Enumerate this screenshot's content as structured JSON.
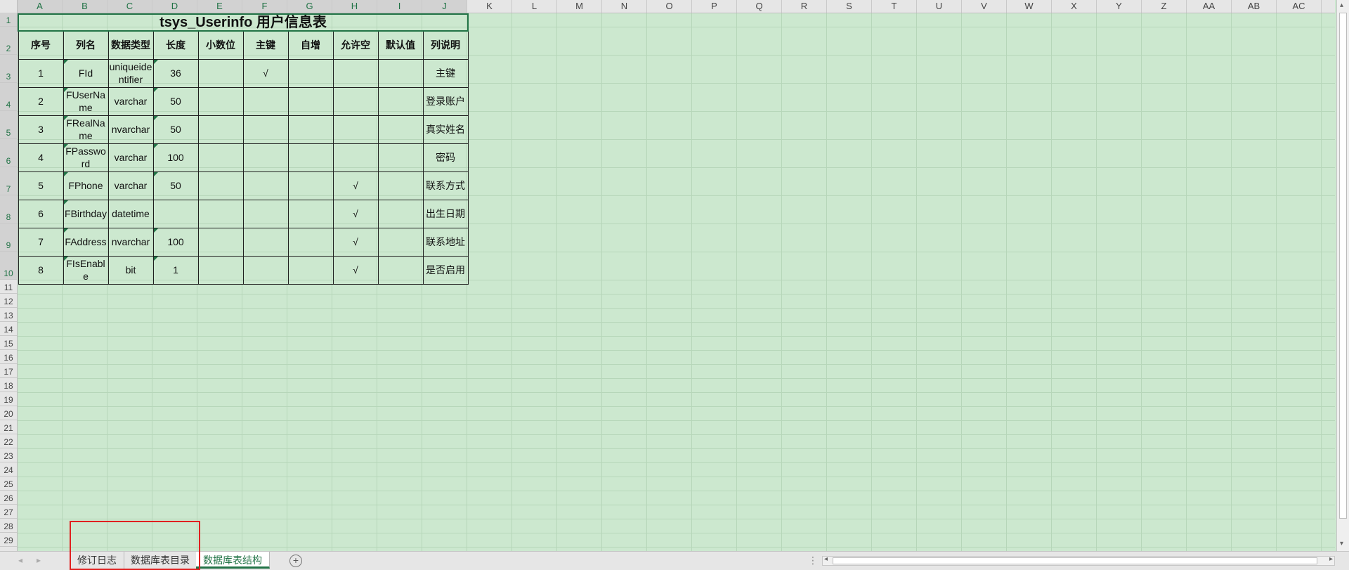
{
  "columns": [
    "A",
    "B",
    "C",
    "D",
    "E",
    "F",
    "G",
    "H",
    "I",
    "J",
    "K",
    "L",
    "M",
    "N",
    "O",
    "P",
    "Q",
    "R",
    "S",
    "T",
    "U",
    "V",
    "W",
    "X",
    "Y",
    "Z",
    "AA",
    "AB",
    "AC"
  ],
  "rows": [
    "1",
    "2",
    "3",
    "4",
    "5",
    "6",
    "7",
    "8",
    "9",
    "10",
    "11",
    "12",
    "13",
    "14",
    "15",
    "16",
    "17",
    "18",
    "19",
    "20",
    "21",
    "22",
    "23",
    "24",
    "25",
    "26",
    "27",
    "28",
    "29"
  ],
  "table": {
    "title": "tsys_Userinfo 用户信息表",
    "headers": [
      "序号",
      "列名",
      "数据类型",
      "长度",
      "小数位",
      "主键",
      "自增",
      "允许空",
      "默认值",
      "列说明"
    ],
    "rows": [
      [
        "1",
        "FId",
        "uniqueidentifier",
        "36",
        "",
        "√",
        "",
        "",
        "",
        "主键"
      ],
      [
        "2",
        "FUserName",
        "varchar",
        "50",
        "",
        "",
        "",
        "",
        "",
        "登录账户"
      ],
      [
        "3",
        "FRealName",
        "nvarchar",
        "50",
        "",
        "",
        "",
        "",
        "",
        "真实姓名"
      ],
      [
        "4",
        "FPassword",
        "varchar",
        "100",
        "",
        "",
        "",
        "",
        "",
        "密码"
      ],
      [
        "5",
        "FPhone",
        "varchar",
        "50",
        "",
        "",
        "",
        "√",
        "",
        "联系方式"
      ],
      [
        "6",
        "FBirthday",
        "datetime",
        "",
        "",
        "",
        "",
        "√",
        "",
        "出生日期"
      ],
      [
        "7",
        "FAddress",
        "nvarchar",
        "100",
        "",
        "",
        "",
        "√",
        "",
        "联系地址"
      ],
      [
        "8",
        "FIsEnable",
        "bit",
        "1",
        "",
        "",
        "",
        "√",
        "",
        "是否启用"
      ]
    ]
  },
  "sheet_tabs": [
    {
      "label": "修订日志",
      "active": false
    },
    {
      "label": "数据库表目录",
      "active": false
    },
    {
      "label": "数据库表结构",
      "active": true
    }
  ],
  "add_sheet_icon": "plus-circle-icon",
  "colors": {
    "accent": "#217346",
    "grid_bg": "#cce8cf",
    "highlight": "#e02020"
  }
}
